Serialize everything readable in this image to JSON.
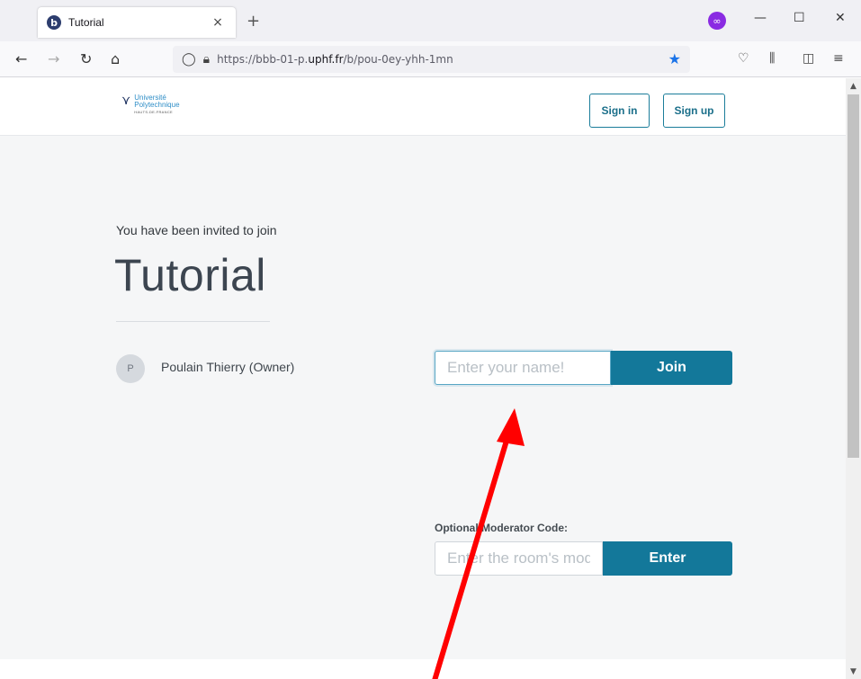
{
  "browser": {
    "tab_title": "Tutorial",
    "tab_favicon_letter": "b",
    "tab_close": "×",
    "new_tab": "+",
    "url_prefix": "https://bbb-01-p.",
    "url_domain": "uphf.fr",
    "url_path": "/b/pou-0ey-yhh-1mn",
    "icons": {
      "back": "back-arrow-icon",
      "forward": "forward-arrow-icon",
      "reload": "reload-icon",
      "home": "home-icon",
      "shield": "tracking-shield-icon",
      "lock": "lock-icon",
      "bookmark": "bookmark-star-icon",
      "pocket": "pocket-icon",
      "library": "library-icon",
      "sidebar": "sidebar-icon",
      "menu": "hamburger-menu-icon",
      "extension": "private-mask-icon"
    }
  },
  "header": {
    "logo": {
      "line1": "Université",
      "line2": "Polytechnique",
      "line3": "HAUTS-DE-FRANCE"
    },
    "sign_in_label": "Sign in",
    "sign_up_label": "Sign up"
  },
  "room": {
    "invite_text": "You have been invited to join",
    "title": "Tutorial",
    "owner_initial": "P",
    "owner_name": "Poulain Thierry (Owner)"
  },
  "join_form": {
    "name_placeholder": "Enter your name!",
    "name_value": "",
    "join_label": "Join"
  },
  "moderator_form": {
    "label": "Optional Moderator Code:",
    "code_placeholder": "Enter the room's moderator code",
    "enter_label": "Enter"
  },
  "colors": {
    "primary": "#13789a",
    "annotation_arrow": "#ff0000",
    "page_bg": "#f5f6f7"
  }
}
